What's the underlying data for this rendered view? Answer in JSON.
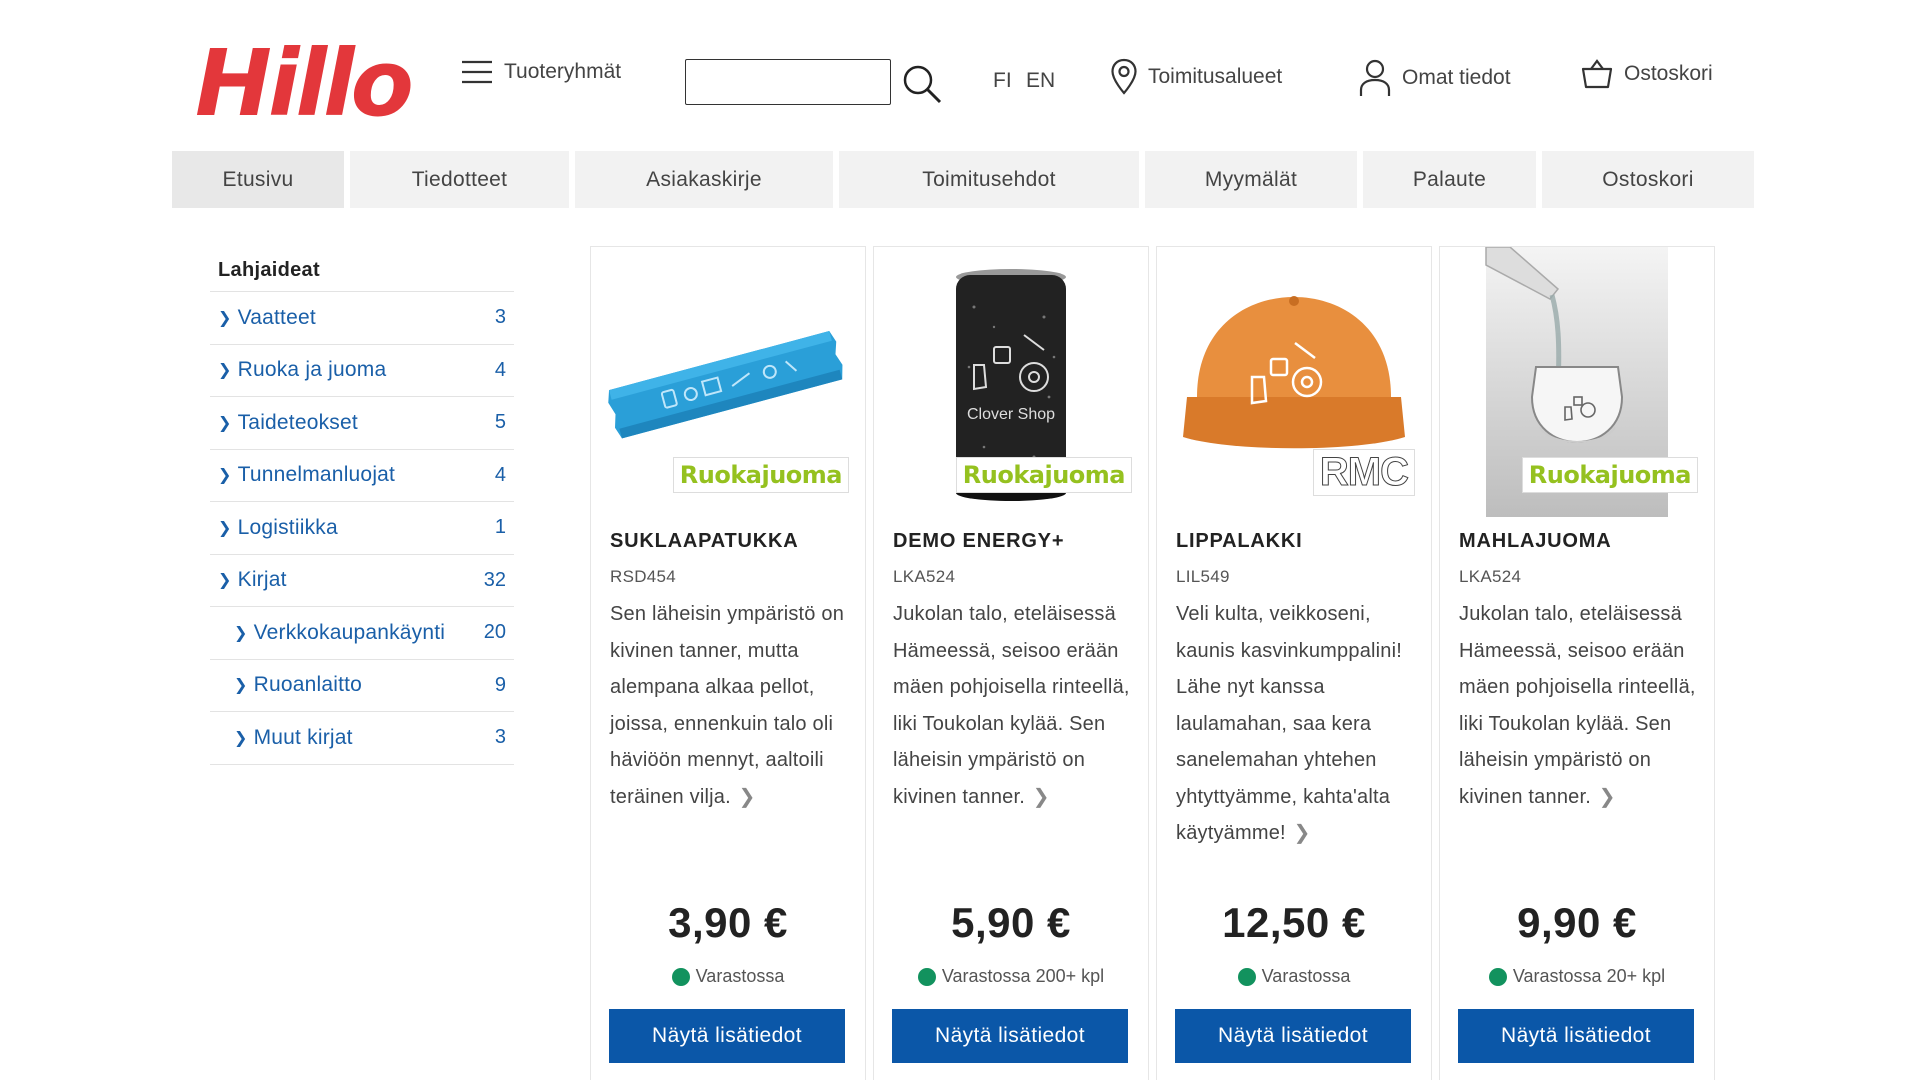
{
  "header": {
    "logo": "Hillo",
    "menu_label": "Tuoteryhmät",
    "search": {
      "value": "",
      "placeholder": ""
    },
    "lang_fi": "FI",
    "lang_en": "EN",
    "delivery_label": "Toimitusalueet",
    "account_label": "Omat tiedot",
    "cart_label": "Ostoskori"
  },
  "nav": {
    "tabs": [
      {
        "label": "Etusivu",
        "active": true
      },
      {
        "label": "Tiedotteet"
      },
      {
        "label": "Asiakaskirje"
      },
      {
        "label": "Toimitusehdot"
      },
      {
        "label": "Myymälät"
      },
      {
        "label": "Palaute"
      },
      {
        "label": "Ostoskori"
      }
    ]
  },
  "sidebar": {
    "title": "Lahjaideat",
    "items": [
      {
        "label": "Vaatteet",
        "count": "3"
      },
      {
        "label": "Ruoka ja juoma",
        "count": "4"
      },
      {
        "label": "Taideteokset",
        "count": "5"
      },
      {
        "label": "Tunnelmanluojat",
        "count": "4"
      },
      {
        "label": "Logistiikka",
        "count": "1"
      },
      {
        "label": "Kirjat",
        "count": "32"
      },
      {
        "label": "Verkkokaupankäynti",
        "count": "20"
      },
      {
        "label": "Ruoanlaitto",
        "count": "9"
      },
      {
        "label": "Muut kirjat",
        "count": "3"
      }
    ]
  },
  "products": [
    {
      "title": "SUKLAAPATUKKA",
      "sku": "RSD454",
      "description": "Sen läheisin ympäristö on kivinen tanner, mutta alempana alkaa pellot, joissa, ennenkuin talo oli häviöön mennyt, aaltoili teräinen vilja.",
      "badge": "Ruokajuoma",
      "price": "3,90 €",
      "stock": "Varastossa",
      "button": "Näytä lisätiedot",
      "image_text": ""
    },
    {
      "title": "DEMO ENERGY+",
      "sku": "LKA524",
      "description": "Jukolan talo, eteläisessä Hämeessä, seisoo erään mäen pohjoisella rinteellä, liki Toukolan kylää. Sen läheisin ympäristö on kivinen tanner.",
      "badge": "Ruokajuoma",
      "price": "5,90 €",
      "stock": "Varastossa 200+ kpl",
      "button": "Näytä lisätiedot",
      "image_text": "Clover Shop"
    },
    {
      "title": "LIPPALAKKI",
      "sku": "LIL549",
      "description": "Veli kulta, veikkoseni, kaunis kasvinkumppalini! Lähe nyt kanssa laulamahan, saa kera sanelemahan yhtehen yhtyttyämme, kahta'alta käytyämme!",
      "badge": "RMC",
      "price": "12,50 €",
      "stock": "Varastossa",
      "button": "Näytä lisätiedot",
      "image_text": ""
    },
    {
      "title": "MAHLAJUOMA",
      "sku": "LKA524",
      "description": "Jukolan talo, eteläisessä Hämeessä, seisoo erään mäen pohjoisella rinteellä, liki Toukolan kylää. Sen läheisin ympäristö on kivinen tanner.",
      "badge": "Ruokajuoma",
      "price": "9,90 €",
      "stock": "Varastossa 20+ kpl",
      "button": "Näytä lisätiedot",
      "image_text": ""
    }
  ],
  "colors": {
    "brand_red": "#e3373b",
    "link_blue": "#1a5fa8",
    "button_blue": "#0b57a8",
    "stock_green": "#12925e",
    "badge_green": "#95c11f"
  }
}
